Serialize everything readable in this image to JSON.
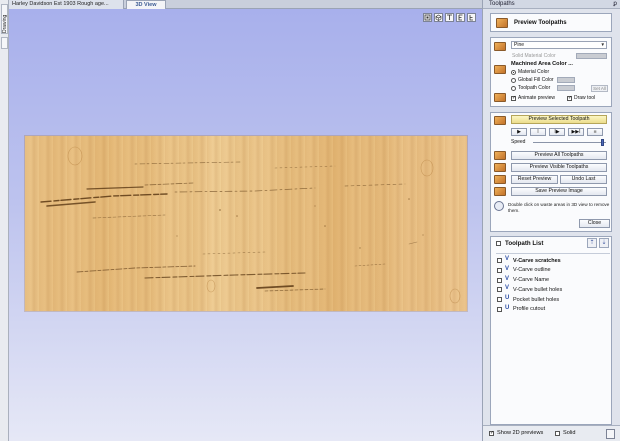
{
  "left_strip": {
    "tab_label": "Drawing"
  },
  "tabs": [
    {
      "label": "Harley Davidson Est 1903 Rough age..."
    },
    {
      "label": "3D View"
    }
  ],
  "view_tools": [
    "view-box-icon",
    "view-iso-icon",
    "view-top-icon",
    "view-front-icon",
    "view-side-icon"
  ],
  "panel": {
    "title": "Toolpaths",
    "pin": "ꝑ",
    "header": "Preview Toolpaths",
    "material": {
      "selected": "Pine",
      "solid_label": "Solid Material Color",
      "machined_heading": "Machined Area Color ...",
      "options": [
        "Material Color",
        "Global Fill Color",
        "Toolpath Color"
      ],
      "selected_option": "Material Color",
      "set_all": "Set All",
      "animate_label": "Animate preview",
      "draw_tool_label": "Draw tool",
      "animate_checked": true,
      "draw_tool_checked": true
    },
    "controls": {
      "preview_selected": "Preview Selected Toolpath",
      "playback": [
        "▶",
        "II",
        "I▶",
        "▶▶I",
        "■"
      ],
      "speed_label": "Speed",
      "speed_level": 0.97,
      "preview_all": "Preview All Toolpaths",
      "preview_visible": "Preview Visible Toolpaths",
      "reset_preview": "Reset Preview",
      "undo_last": "Undo Last",
      "save_image": "Save Preview Image",
      "hint": "Double click on waste areas in 3D view to remove them."
    },
    "close": "Close",
    "toolpath_list": {
      "title": "Toolpath List",
      "items": [
        {
          "name": "V-Carve scratches",
          "kind": "V",
          "bold": true
        },
        {
          "name": "V-Carve outline",
          "kind": "V",
          "bold": false
        },
        {
          "name": "V-Carve Name",
          "kind": "V",
          "bold": false
        },
        {
          "name": "V-Carve bullet holes",
          "kind": "V",
          "bold": false
        },
        {
          "name": "Pocket bullet holes",
          "kind": "U",
          "bold": false
        },
        {
          "name": "Profile cutout",
          "kind": "U",
          "bold": false
        }
      ]
    },
    "footer": {
      "show_2d": "Show 2D previews",
      "solid": "Solid",
      "show_2d_checked": true,
      "solid_checked": false
    }
  },
  "colors": {
    "viewport_top": "#a8b0ec",
    "viewport_bottom": "#e6e8f6",
    "wood": "#ebc58a",
    "accent": "#2d4fa5"
  }
}
